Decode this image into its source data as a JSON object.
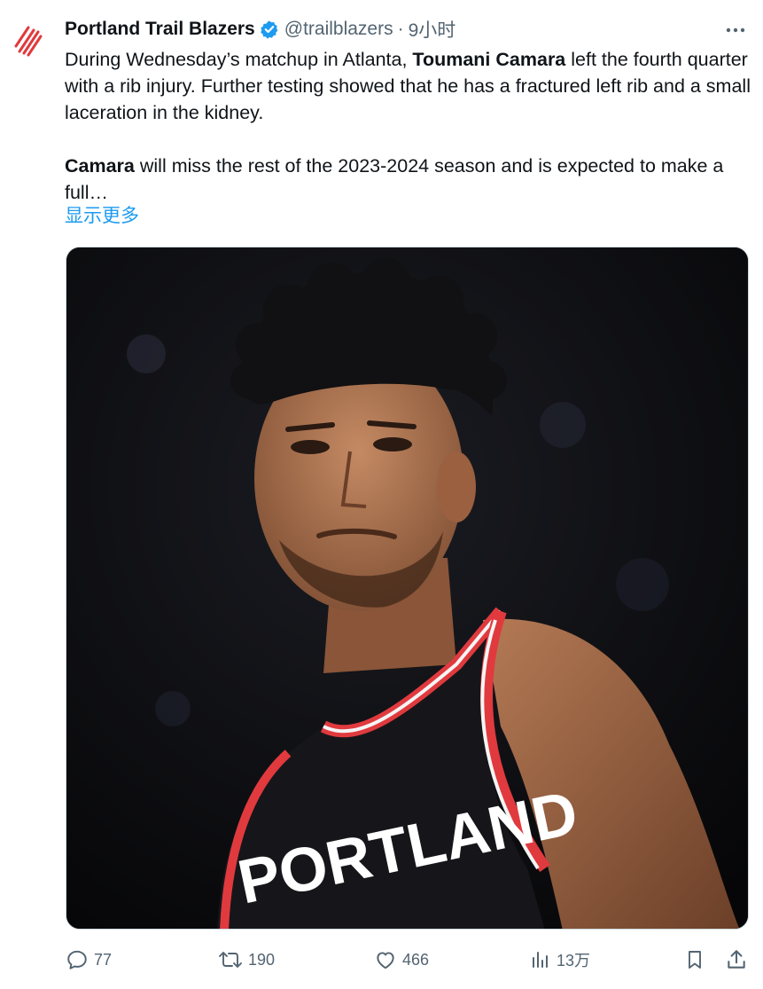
{
  "tweet": {
    "author_name": "Portland Trail Blazers",
    "handle": "@trailblazers",
    "separator": "·",
    "time": "9小时",
    "paragraph1": {
      "before": "During Wednesday’s matchup in Atlanta, ",
      "bold": "Toumani Camara",
      "after": " left the fourth quarter with a rib injury. Further testing showed that he has a fractured left rib and a small laceration in the kidney."
    },
    "paragraph2": {
      "bold": "Camara",
      "after": " will miss the rest of the 2023-2024 season and is expected to make a full…"
    },
    "show_more": "显示更多",
    "media": {
      "jersey_text": "PORTLAND"
    }
  },
  "actions": {
    "reply_count": "77",
    "retweet_count": "190",
    "like_count": "466",
    "views_count": "13万"
  },
  "icons": {
    "avatar": "trail-blazers-logo",
    "verified": "verified-badge-icon",
    "more": "more-options-icon",
    "reply": "reply-icon",
    "retweet": "retweet-icon",
    "like": "heart-icon",
    "views": "views-chart-icon",
    "bookmark": "bookmark-icon",
    "share": "share-icon"
  },
  "colors": {
    "link": "#1d9bf0",
    "brand_red": "#e03a3e",
    "secondary_text": "#536471",
    "verified": "#1d9bf0"
  }
}
